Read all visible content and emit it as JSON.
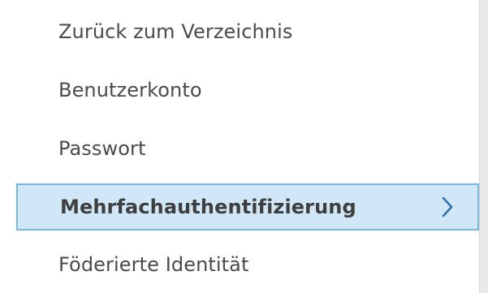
{
  "menu": {
    "items": [
      {
        "label": "Zurück zum Verzeichnis",
        "active": false
      },
      {
        "label": "Benutzerkonto",
        "active": false
      },
      {
        "label": "Passwort",
        "active": false
      },
      {
        "label": "Mehrfachauthentifizierung",
        "active": true
      },
      {
        "label": "Föderierte Identität",
        "active": false
      }
    ]
  },
  "colors": {
    "active_background": "#cfe7f6",
    "active_border": "#7bb6dc",
    "text": "#4b4b4b",
    "chevron": "#2b73b5"
  },
  "icons": {
    "active_indicator": "chevron-right-icon"
  }
}
